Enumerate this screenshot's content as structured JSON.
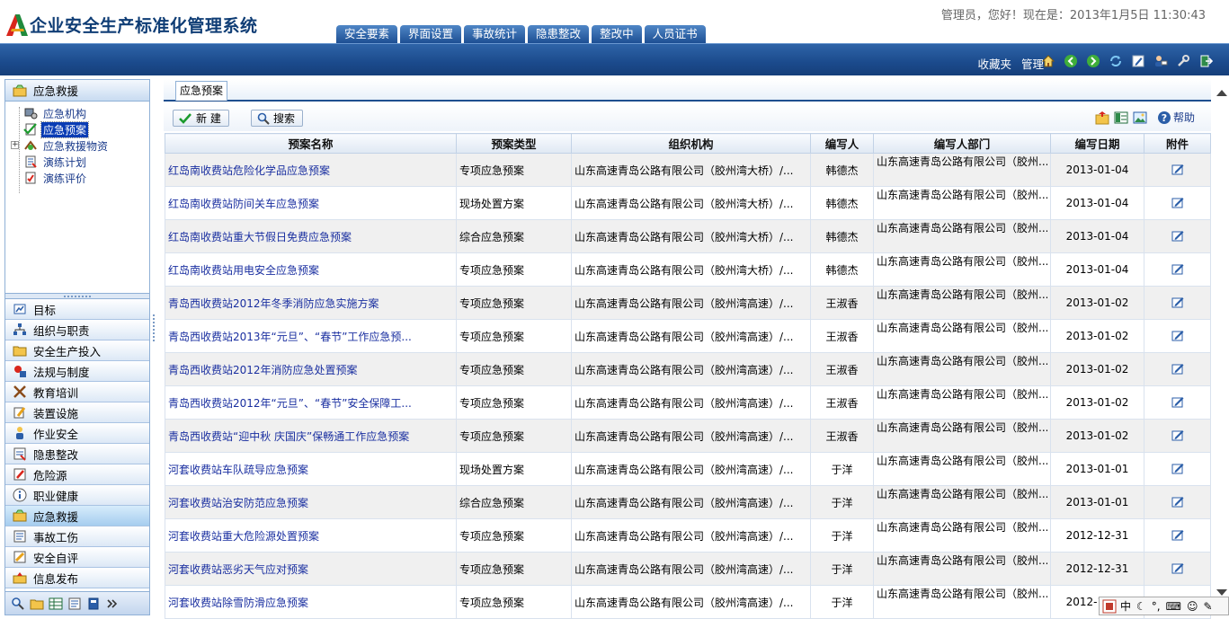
{
  "app": {
    "title": "企业安全生产标准化管理系统",
    "greeting": "管理员，您好！现在是：2013年1月5日  11:30:43"
  },
  "top_tabs": [
    "安全要素",
    "界面设置",
    "事故统计",
    "隐患整改",
    "整改中",
    "人员证书"
  ],
  "toolbar": {
    "links": [
      "收藏夹",
      "管理"
    ],
    "icons": [
      "home-icon",
      "back-icon",
      "forward-icon",
      "refresh-icon",
      "edit-icon",
      "user-icon",
      "tools-icon",
      "exit-icon"
    ]
  },
  "sidebar": {
    "section_title": "应急救援",
    "tree": [
      {
        "label": "应急机构",
        "icon": "org-icon"
      },
      {
        "label": "应急预案",
        "icon": "check-doc-icon",
        "selected": true
      },
      {
        "label": "应急救援物资",
        "icon": "supplies-icon",
        "expandable": true,
        "expander": "+"
      },
      {
        "label": "演练计划",
        "icon": "plan-icon"
      },
      {
        "label": "演练评价",
        "icon": "evaluate-icon"
      }
    ],
    "modules": [
      {
        "label": "目标",
        "icon": "target-icon"
      },
      {
        "label": "组织与职责",
        "icon": "org-chart-icon"
      },
      {
        "label": "安全生产投入",
        "icon": "folder-icon"
      },
      {
        "label": "法规与制度",
        "icon": "law-icon"
      },
      {
        "label": "教育培训",
        "icon": "training-icon"
      },
      {
        "label": "装置设施",
        "icon": "device-icon"
      },
      {
        "label": "作业安全",
        "icon": "worker-icon"
      },
      {
        "label": "隐患整改",
        "icon": "hazard-fix-icon"
      },
      {
        "label": "危险源",
        "icon": "danger-icon"
      },
      {
        "label": "职业健康",
        "icon": "info-icon"
      },
      {
        "label": "应急救援",
        "icon": "rescue-icon",
        "active": true
      },
      {
        "label": "事故工伤",
        "icon": "accident-icon"
      },
      {
        "label": "安全自评",
        "icon": "self-eval-icon"
      },
      {
        "label": "信息发布",
        "icon": "publish-icon"
      }
    ]
  },
  "main": {
    "tab_label": "应急预案",
    "new_button": "新 建",
    "search_button": "搜索",
    "help_label": "帮助",
    "columns": [
      "预案名称",
      "预案类型",
      "组织机构",
      "编写人",
      "编写人部门",
      "编写日期",
      "附件"
    ],
    "rows": [
      {
        "name": "红岛南收费站危险化学品应急预案",
        "type": "专项应急预案",
        "org": "山东高速青岛公路有限公司（胶州湾大桥）/...",
        "author": "韩德杰",
        "dept": "山东高速青岛公路有限公司（胶州...",
        "date": "2013-01-04"
      },
      {
        "name": "红岛南收费站防间关车应急预案",
        "type": "现场处置方案",
        "org": "山东高速青岛公路有限公司（胶州湾大桥）/...",
        "author": "韩德杰",
        "dept": "山东高速青岛公路有限公司（胶州...",
        "date": "2013-01-04"
      },
      {
        "name": "红岛南收费站重大节假日免费应急预案",
        "type": "综合应急预案",
        "org": "山东高速青岛公路有限公司（胶州湾大桥）/...",
        "author": "韩德杰",
        "dept": "山东高速青岛公路有限公司（胶州...",
        "date": "2013-01-04"
      },
      {
        "name": "红岛南收费站用电安全应急预案",
        "type": "专项应急预案",
        "org": "山东高速青岛公路有限公司（胶州湾大桥）/...",
        "author": "韩德杰",
        "dept": "山东高速青岛公路有限公司（胶州...",
        "date": "2013-01-04"
      },
      {
        "name": "青岛西收费站2012年冬季消防应急实施方案",
        "type": "专项应急预案",
        "org": "山东高速青岛公路有限公司（胶州湾高速）/...",
        "author": "王淑香",
        "dept": "山东高速青岛公路有限公司（胶州...",
        "date": "2013-01-02"
      },
      {
        "name": "青岛西收费站2013年“元旦”、“春节”工作应急预...",
        "type": "专项应急预案",
        "org": "山东高速青岛公路有限公司（胶州湾高速）/...",
        "author": "王淑香",
        "dept": "山东高速青岛公路有限公司（胶州...",
        "date": "2013-01-02"
      },
      {
        "name": "青岛西收费站2012年消防应急处置预案",
        "type": "专项应急预案",
        "org": "山东高速青岛公路有限公司（胶州湾高速）/...",
        "author": "王淑香",
        "dept": "山东高速青岛公路有限公司（胶州...",
        "date": "2013-01-02"
      },
      {
        "name": "青岛西收费站2012年“元旦”、“春节”安全保障工...",
        "type": "专项应急预案",
        "org": "山东高速青岛公路有限公司（胶州湾高速）/...",
        "author": "王淑香",
        "dept": "山东高速青岛公路有限公司（胶州...",
        "date": "2013-01-02"
      },
      {
        "name": "青岛西收费站“迎中秋 庆国庆”保畅通工作应急预案",
        "type": "专项应急预案",
        "org": "山东高速青岛公路有限公司（胶州湾高速）/...",
        "author": "王淑香",
        "dept": "山东高速青岛公路有限公司（胶州...",
        "date": "2013-01-02"
      },
      {
        "name": "河套收费站车队疏导应急预案",
        "type": "现场处置方案",
        "org": "山东高速青岛公路有限公司（胶州湾高速）/...",
        "author": "于洋",
        "dept": "山东高速青岛公路有限公司（胶州...",
        "date": "2013-01-01"
      },
      {
        "name": "河套收费站治安防范应急预案",
        "type": "综合应急预案",
        "org": "山东高速青岛公路有限公司（胶州湾高速）/...",
        "author": "于洋",
        "dept": "山东高速青岛公路有限公司（胶州...",
        "date": "2013-01-01"
      },
      {
        "name": "河套收费站重大危险源处置预案",
        "type": "专项应急预案",
        "org": "山东高速青岛公路有限公司（胶州湾高速）/...",
        "author": "于洋",
        "dept": "山东高速青岛公路有限公司（胶州...",
        "date": "2012-12-31"
      },
      {
        "name": "河套收费站恶劣天气应对预案",
        "type": "专项应急预案",
        "org": "山东高速青岛公路有限公司（胶州湾高速）/...",
        "author": "于洋",
        "dept": "山东高速青岛公路有限公司（胶州...",
        "date": "2012-12-31"
      },
      {
        "name": "河套收费站除雪防滑应急预案",
        "type": "专项应急预案",
        "org": "山东高速青岛公路有限公司（胶州湾高速）/...",
        "author": "于洋",
        "dept": "山东高速青岛公路有限公司（胶州...",
        "date": "2012-12-31"
      }
    ]
  },
  "ime_bar": {
    "label": "中"
  },
  "colors": {
    "header_blue": "#1d4f93",
    "link_blue": "#1a2fa0",
    "selected": "#0a3cb4"
  }
}
